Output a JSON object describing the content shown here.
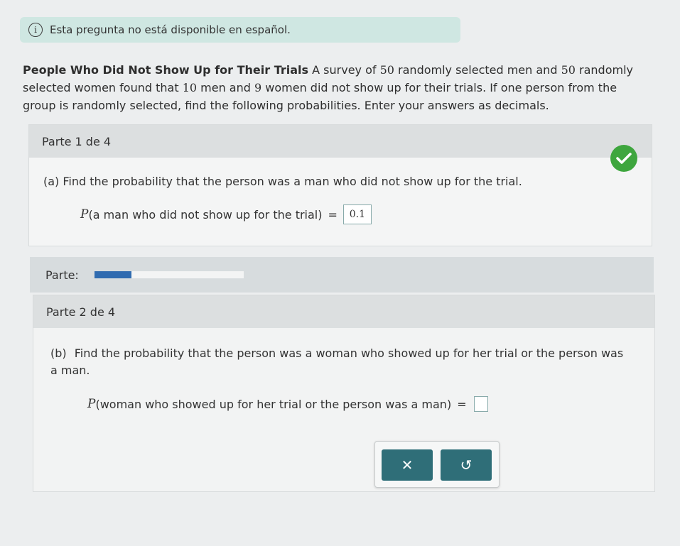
{
  "banner": {
    "text": "Esta pregunta no está disponible en español."
  },
  "problem": {
    "title": "People Who Did Not Show Up for Their Trials",
    "t1": " A survey of ",
    "n_men": "50",
    "t2": " randomly selected men and ",
    "n_women": "50",
    "t3": " randomly selected women found that ",
    "n_men_noshow": "10",
    "t4": " men and ",
    "n_women_noshow": "9",
    "t5": " women did not show up for their trials. If one person from the group is randomly selected, find the following probabilities. Enter your answers as decimals."
  },
  "part1": {
    "header": "Parte 1 de 4",
    "question": "(a)  Find the probability that the person was a man who did not show up for the trial.",
    "expr_p": "P",
    "expr_text": "(a man who did not show up for the trial)",
    "equals": "=",
    "answer": "0.1"
  },
  "progress": {
    "label": "Parte:",
    "fraction": 0.25
  },
  "part2": {
    "header": "Parte 2 de 4",
    "q_label": "(b)",
    "question": "Find the probability that the person was a woman who showed up for her trial or the person was a man.",
    "expr_p": "P",
    "expr_text": "(woman who showed up for her trial or the person was a man)",
    "equals": "="
  },
  "buttons": {
    "clear": "✕",
    "undo": "↺"
  },
  "colors": {
    "check": "#3ea63e",
    "button": "#2f6e78",
    "progress": "#2f6bb0"
  }
}
